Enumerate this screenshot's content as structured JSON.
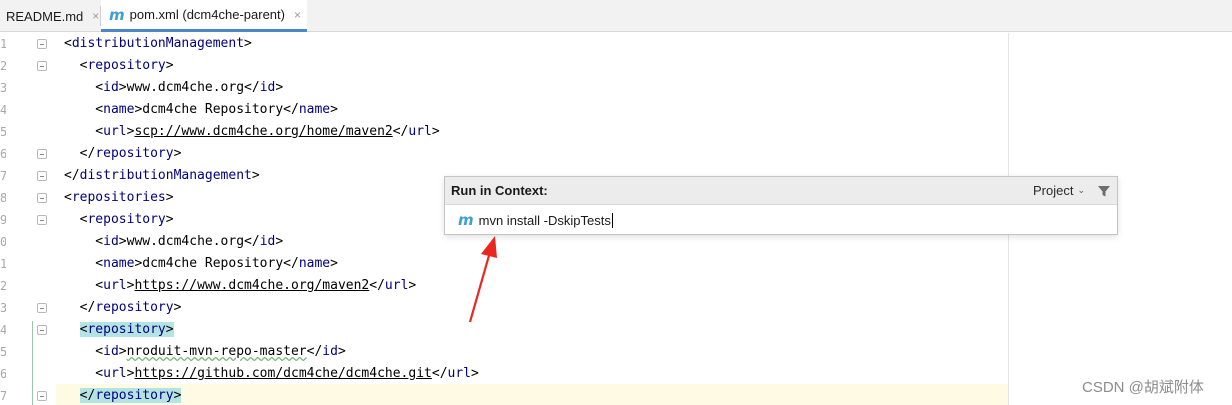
{
  "tabs": [
    {
      "label": "README.md",
      "close": "×"
    },
    {
      "label": "pom.xml (dcm4che-parent)",
      "close": "×",
      "icon": "m",
      "active": true
    }
  ],
  "line_numbers": [
    "1",
    "2",
    "3",
    "4",
    "5",
    "6",
    "7",
    "8",
    "9",
    "0",
    "1",
    "2",
    "3",
    "4",
    "5",
    "6",
    "7"
  ],
  "code": {
    "l1": {
      "open": "<",
      "tag": "distributionManagement",
      "close": ">"
    },
    "l2": {
      "open": "<",
      "tag": "repository",
      "close": ">"
    },
    "l3": {
      "tag": "id",
      "value": "www.dcm4che.org"
    },
    "l4": {
      "tag": "name",
      "value": "dcm4che Repository"
    },
    "l5": {
      "tag": "url",
      "value": "scp://www.dcm4che.org/home/maven2"
    },
    "l6": {
      "tag": "repository"
    },
    "l7": {
      "tag": "distributionManagement"
    },
    "l8": {
      "tag": "repositories"
    },
    "l9": {
      "tag": "repository"
    },
    "l10": {
      "tag": "id",
      "value": "www.dcm4che.org"
    },
    "l11": {
      "tag": "name",
      "value": "dcm4che Repository"
    },
    "l12": {
      "tag": "url",
      "value": "https://www.dcm4che.org/maven2"
    },
    "l13": {
      "tag": "repository"
    },
    "l14": {
      "tag": "repository"
    },
    "l15": {
      "tag": "id",
      "value": "nroduit-mvn-repo-master"
    },
    "l16": {
      "tag": "url",
      "value": "https://github.com/dcm4che/dcm4che.git"
    },
    "l17": {
      "tag": "repository"
    }
  },
  "popup": {
    "title": "Run in Context:",
    "scope": "Project",
    "icon": "m",
    "command": "mvn install -DskipTests"
  },
  "watermark": "CSDN @胡斌附体",
  "colors": {
    "tag": "#000080",
    "popup_header": "#ececec",
    "arrow": "#e8281e",
    "maven_icon": "#3ca0d6"
  }
}
